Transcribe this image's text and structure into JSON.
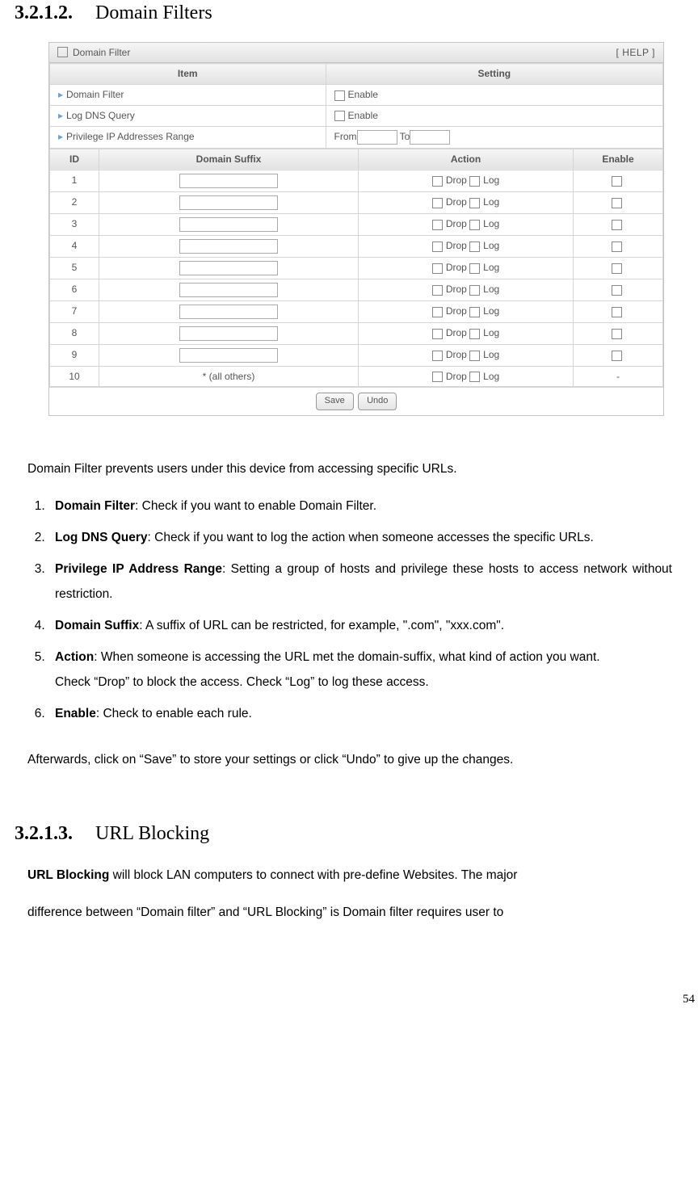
{
  "sec1": {
    "num": "3.2.1.2.",
    "title": "Domain Filters"
  },
  "panel": {
    "title": "Domain Filter",
    "help": "[ HELP ]",
    "item_hdr": "Item",
    "setting_hdr": "Setting",
    "row_df": "Domain Filter",
    "row_log": "Log DNS Query",
    "row_priv": "Privilege IP Addresses Range",
    "enable": "Enable",
    "from": "From",
    "to": "To",
    "id_hdr": "ID",
    "suf_hdr": "Domain Suffix",
    "act_hdr": "Action",
    "en_hdr": "Enable",
    "ids": [
      "1",
      "2",
      "3",
      "4",
      "5",
      "6",
      "7",
      "8",
      "9",
      "10"
    ],
    "all_others": "* (all others)",
    "drop": "Drop",
    "log": "Log",
    "dash": "-",
    "save": "Save",
    "undo": "Undo"
  },
  "body": {
    "intro": "Domain Filter prevents users under this device from accessing specific URLs.",
    "items": [
      {
        "b": "Domain Filter",
        "t": ": Check if you want to enable Domain Filter."
      },
      {
        "b": "Log DNS Query",
        "t": ": Check if you want to log the action when someone accesses the specific URLs."
      },
      {
        "b": "Privilege IP Address Range",
        "t": ": Setting a group of hosts and privilege these hosts to access network without restriction."
      },
      {
        "b": "Domain Suffix",
        "t": ": A suffix of URL can be restricted, for example, \".com\", \"xxx.com\"."
      },
      {
        "b": "Action",
        "t": ": When someone is accessing the URL met the domain-suffix, what kind of action you want.",
        "sub": "Check “Drop” to block the access. Check “Log” to log these access."
      },
      {
        "b": "Enable",
        "t": ": Check to enable each rule."
      }
    ],
    "after": "Afterwards, click on “Save” to store your settings or click “Undo” to give up the changes."
  },
  "sec2": {
    "num": "3.2.1.3.",
    "title": "URL Blocking"
  },
  "body2": {
    "p1a": "URL Blocking",
    "p1b": " will block LAN computers to connect with pre-define Websites. The major",
    "p2": "difference between “Domain filter” and “URL Blocking” is Domain filter requires user to"
  },
  "pgnum": "54",
  "chart_data": {
    "type": "table",
    "title": "Domain Filter rules table",
    "columns": [
      "ID",
      "Domain Suffix",
      "Action",
      "Enable"
    ],
    "rows": [
      {
        "ID": 1,
        "Domain Suffix": "",
        "Action": "Drop / Log (unchecked)",
        "Enable": "unchecked"
      },
      {
        "ID": 2,
        "Domain Suffix": "",
        "Action": "Drop / Log (unchecked)",
        "Enable": "unchecked"
      },
      {
        "ID": 3,
        "Domain Suffix": "",
        "Action": "Drop / Log (unchecked)",
        "Enable": "unchecked"
      },
      {
        "ID": 4,
        "Domain Suffix": "",
        "Action": "Drop / Log (unchecked)",
        "Enable": "unchecked"
      },
      {
        "ID": 5,
        "Domain Suffix": "",
        "Action": "Drop / Log (unchecked)",
        "Enable": "unchecked"
      },
      {
        "ID": 6,
        "Domain Suffix": "",
        "Action": "Drop / Log (unchecked)",
        "Enable": "unchecked"
      },
      {
        "ID": 7,
        "Domain Suffix": "",
        "Action": "Drop / Log (unchecked)",
        "Enable": "unchecked"
      },
      {
        "ID": 8,
        "Domain Suffix": "",
        "Action": "Drop / Log (unchecked)",
        "Enable": "unchecked"
      },
      {
        "ID": 9,
        "Domain Suffix": "",
        "Action": "Drop / Log (unchecked)",
        "Enable": "unchecked"
      },
      {
        "ID": 10,
        "Domain Suffix": "* (all others)",
        "Action": "Drop / Log (unchecked)",
        "Enable": "-"
      }
    ],
    "settings": [
      {
        "Item": "Domain Filter",
        "Setting": "Enable (unchecked)"
      },
      {
        "Item": "Log DNS Query",
        "Setting": "Enable (unchecked)"
      },
      {
        "Item": "Privilege IP Addresses Range",
        "Setting": "From [] To []"
      }
    ]
  }
}
